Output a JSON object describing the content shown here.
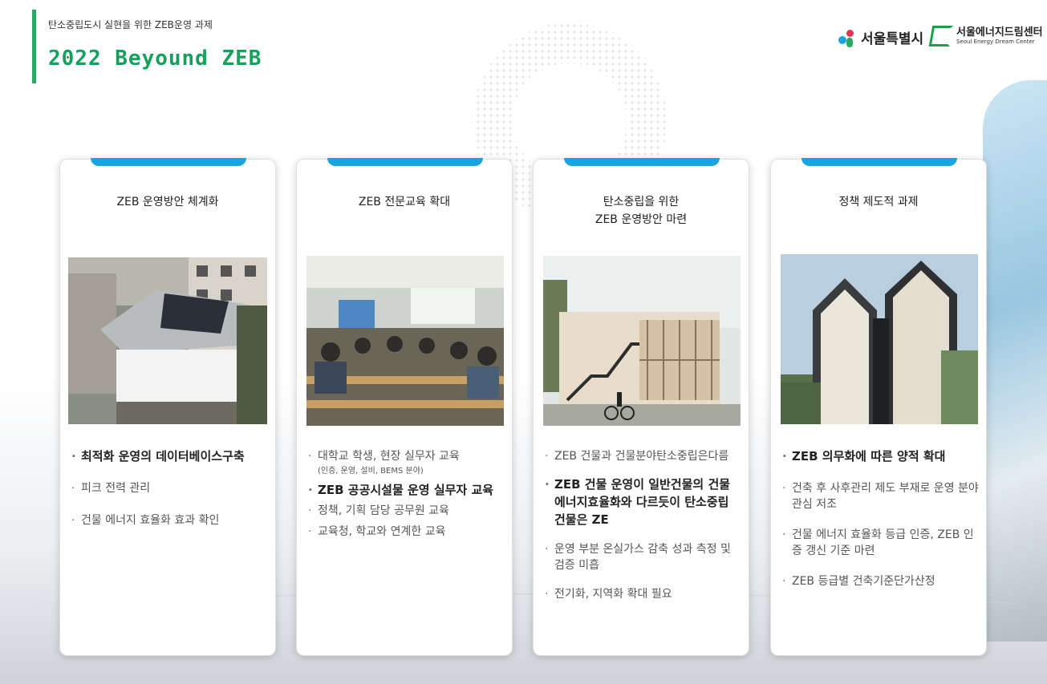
{
  "header": {
    "subtitle": "탄소중립도시 실현을 위한 ZEB운영 과제",
    "title": "2022 Beyound ZEB"
  },
  "logos": {
    "seoul": "서울특별시",
    "center_name": "서울에너지드림센터",
    "center_en": "Seoul Energy Dream Center"
  },
  "colors": {
    "accent_green": "#13a15b",
    "tab_blue": "#1ba3dd"
  },
  "cards": [
    {
      "title": "ZEB 운영방안 체계화",
      "photo": "photo-solar-roof-building",
      "bullets": [
        {
          "text": "최적화 운영의 데이터베이스구축",
          "style": "bold"
        },
        {
          "text": "피크 전력 관리",
          "style": "normal"
        },
        {
          "text": "건물 에너지 효율화 효과 확인",
          "style": "normal"
        }
      ]
    },
    {
      "title": "ZEB 전문교육 확대",
      "photo": "photo-seminar-classroom",
      "bullets": [
        {
          "text": "대학교 학생, 현장 실무자 교육",
          "style": "normal"
        },
        {
          "text": "(인증, 운영, 설비, BEMS 분야)",
          "style": "small"
        },
        {
          "text": "ZEB 공공시설물 운영 실무자 교육",
          "style": "bold"
        },
        {
          "text": "정책, 기획 담당 공무원 교육",
          "style": "normal"
        },
        {
          "text": "교육청, 학교와 연계한 교육",
          "style": "normal"
        }
      ]
    },
    {
      "title": "탄소중립을 위한\nZEB 운영방안 마련",
      "photo": "photo-wooden-building-cyclist",
      "bullets": [
        {
          "text": "ZEB 건물과 건물분야탄소중립은다름",
          "style": "normal"
        },
        {
          "text": "ZEB 건물 운영이 일반건물의 건물 에너지효율화와 다르듯이 탄소중립 건물은 ZE",
          "style": "bold"
        },
        {
          "text": "운영 부분 온실가스 감축 성과 측정 및 검증 미흡",
          "style": "normal"
        },
        {
          "text": "전기화, 지역화 확대 필요",
          "style": "normal"
        }
      ]
    },
    {
      "title": "정책 제도적 과제",
      "photo": "photo-modern-gable-building",
      "bullets": [
        {
          "text": "ZEB 의무화에 따른 양적 확대",
          "style": "bold"
        },
        {
          "text": "건축 후 사후관리 제도 부재로 운영 분야 관심 저조",
          "style": "normal"
        },
        {
          "text": "건물 에너지 효율화 등급 인증, ZEB 인증 갱신 기준 마련",
          "style": "normal"
        },
        {
          "text": "ZEB 등급별 건축기준단가산정",
          "style": "normal"
        }
      ]
    }
  ]
}
